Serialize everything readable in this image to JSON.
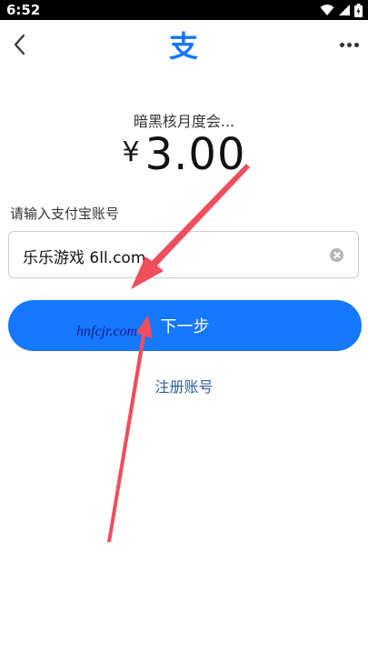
{
  "status_bar": {
    "time": "6:52",
    "icons": [
      "wifi-icon",
      "signal-icon",
      "battery-icon"
    ]
  },
  "nav": {
    "logo_char": "支",
    "back_icon": "chevron-left-icon",
    "more_icon": "more-dots-icon"
  },
  "payment": {
    "merchant": "暗黑核月度会...",
    "currency": "¥",
    "amount": "3.00"
  },
  "form": {
    "account_label": "请输入支付宝账号",
    "account_value": "乐乐游戏 6ll.com",
    "clear_icon": "clear-icon",
    "next_button": "下一步",
    "register_link": "注册账号"
  },
  "overlay": {
    "watermark": "hnfcjr.com",
    "arrow_color": "#ef4e5c"
  },
  "colors": {
    "primary": "#1677ff",
    "link": "#2f5e9e",
    "status_bar": "#000000"
  }
}
